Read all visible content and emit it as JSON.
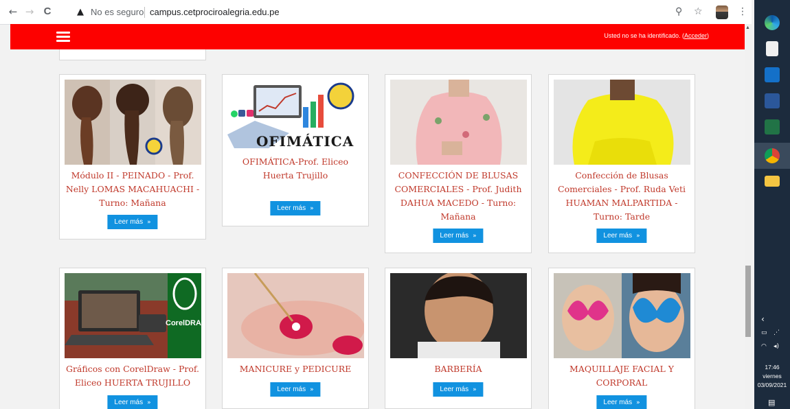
{
  "browser": {
    "insecure_label": "No es seguro",
    "url": "campus.cetprociroalegria.edu.pe",
    "back_icon": "←",
    "forward_icon": "→",
    "reload_icon": "C",
    "warning_icon": "▲",
    "zoom_icon": "⚲",
    "star_icon": "☆",
    "menu_icon": "⋮"
  },
  "header": {
    "color": "#fd0100",
    "login_text": "Usted no se ha identificado. (",
    "login_link": "Acceder",
    "login_close": ")"
  },
  "button_label": "Leer más",
  "button_chevron": "»",
  "courses": [
    {
      "title": "Módulo II - PEINADO - Prof. Nelly LOMAS MACAHUACHI - Turno: Mañana",
      "button": "Leer más"
    },
    {
      "title": "OFIMÁTICA-Prof. Eliceo Huerta Trujillo",
      "button": "Leer más",
      "image_text": "OFIMÁTICA"
    },
    {
      "title": "CONFECCIÓN DE BLUSAS COMERCIALES - Prof. Judith DAHUA MACEDO - Turno: Mañana",
      "button": "Leer más"
    },
    {
      "title": "Confección de Blusas Comerciales - Prof. Ruda Veti HUAMAN MALPARTIDA - Turno: Tarde",
      "button": "Leer más"
    },
    {
      "title": "Gráficos con CorelDraw - Prof. Eliceo HUERTA TRUJILLO",
      "button": "Leer más",
      "image_text": "CorelDRA"
    },
    {
      "title": "MANICURE y PEDICURE",
      "button": "Leer más"
    },
    {
      "title": "BARBERÍA",
      "button": "Leer más"
    },
    {
      "title": "MAQUILLAJE FACIAL Y CORPORAL",
      "button": "Leer más"
    }
  ],
  "taskbar": {
    "time": "17:46",
    "day": "viernes",
    "date": "03/09/2021",
    "icons": [
      "edge-icon",
      "store-icon",
      "mail-icon",
      "word-icon",
      "excel-icon",
      "chrome-icon",
      "file-explorer-icon"
    ]
  },
  "colors": {
    "accent": "#1192e0",
    "title_text": "#c0392b",
    "taskbar": "#1c2b3d"
  }
}
